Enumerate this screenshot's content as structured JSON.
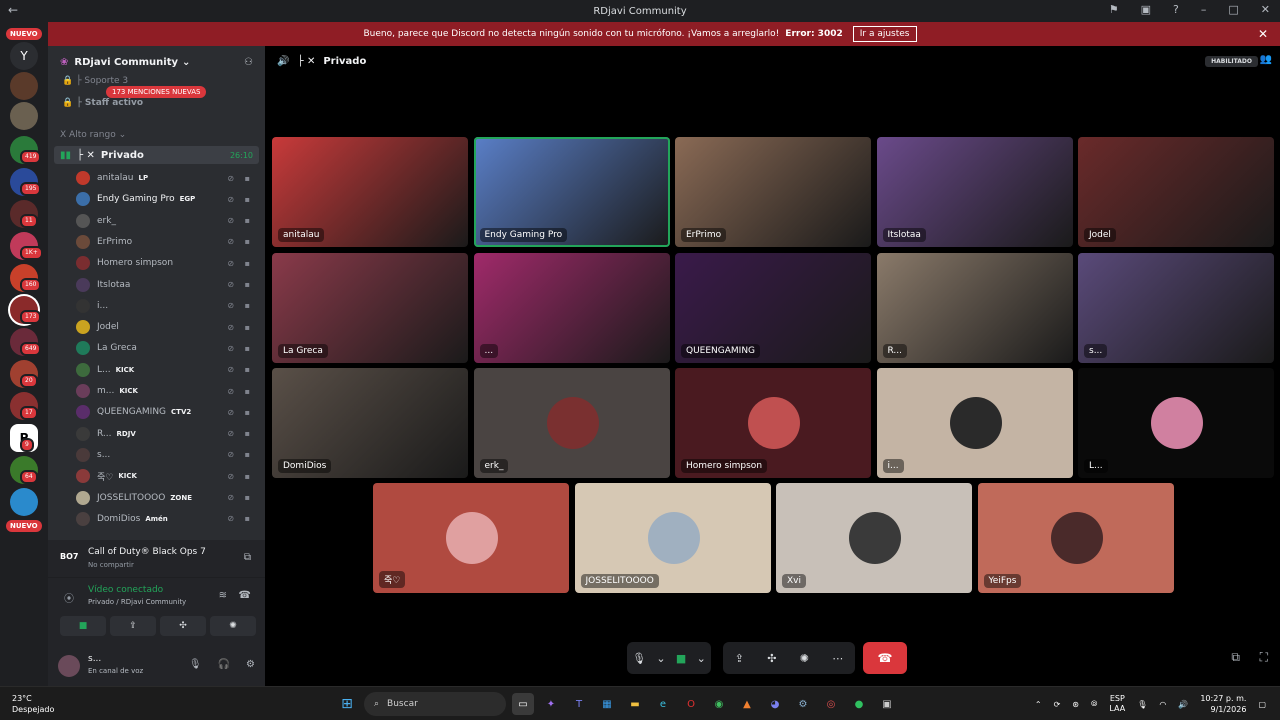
{
  "titlebar": {
    "title": "RDjavi Community"
  },
  "banner": {
    "message": "Bueno, parece que Discord no detecta ningún sonido con tu micrófono. ¡Vamos a arreglarlo!",
    "error": "Error: 3002",
    "button": "Ir a ajustes"
  },
  "guilds": {
    "new_label": "NUEVO",
    "badges": [
      "419",
      "195",
      "11",
      "1K+",
      "160",
      "173",
      "649",
      "20",
      "17",
      "9",
      "64"
    ],
    "new_label_bottom": "NUEVO"
  },
  "server": {
    "name": "RDjavi Community",
    "channels_above": [
      "Soporte 3",
      "Staff activo"
    ],
    "mentions": "173 MENCIONES NUEVAS",
    "category": "Alto rango",
    "voice_channel": "Privado",
    "voice_time": "26:10",
    "members": [
      {
        "name": "anitalau",
        "tag": "LP",
        "color": "#c0392b"
      },
      {
        "name": "Endy Gaming Pro",
        "tag": "EGP",
        "color": "#3b6ea8",
        "bold": true
      },
      {
        "name": "erk_",
        "tag": "",
        "color": "#555555"
      },
      {
        "name": "ErPrimo",
        "tag": "",
        "color": "#6b4a3a"
      },
      {
        "name": "Homero simpson",
        "tag": "",
        "color": "#7a2d30"
      },
      {
        "name": "Itslotaa",
        "tag": "",
        "color": "#4a3a5a"
      },
      {
        "name": "i...",
        "tag": "",
        "color": "#333333"
      },
      {
        "name": "Jodel",
        "tag": "",
        "color": "#caa320"
      },
      {
        "name": "La Greca",
        "tag": "",
        "color": "#1f7a5a"
      },
      {
        "name": "L...",
        "tag": "KICK",
        "color": "#3d6a3d"
      },
      {
        "name": "m...",
        "tag": "KICK",
        "color": "#6a3d5a"
      },
      {
        "name": "QUEENGAMING",
        "tag": "CTV2",
        "color": "#5a2d6a"
      },
      {
        "name": "R...",
        "tag": "RDJV",
        "color": "#3a3a3a"
      },
      {
        "name": "s...",
        "tag": "",
        "color": "#4a3a3a"
      },
      {
        "name": "죽♡",
        "tag": "KICK",
        "color": "#8a3a3a"
      },
      {
        "name": "JOSSELITOOOO",
        "tag": "ZONE",
        "color": "#b0a890"
      },
      {
        "name": "DomiDios",
        "tag": "Amén",
        "color": "#4a4040"
      }
    ],
    "activity": {
      "title": "Call of Duty® Black Ops 7",
      "subtitle": "No compartir",
      "logo": "BO7"
    },
    "voice_status": {
      "title": "Vídeo conectado",
      "subtitle": "Privado / RDjavi Community"
    },
    "user": {
      "name": "s...",
      "status": "En canal de voz"
    }
  },
  "call": {
    "channel": "Privado",
    "enabled_badge": "HABILITADO",
    "tiles": [
      {
        "label": "anitalau",
        "bg": "#c83a3a"
      },
      {
        "label": "Endy Gaming Pro",
        "bg": "#5a7fc8",
        "speaking": true
      },
      {
        "label": "ErPrimo",
        "bg": "#8a6a55"
      },
      {
        "label": "Itslotaa",
        "bg": "#6a4a8a"
      },
      {
        "label": "Jodel",
        "bg": "#6a2a2a"
      },
      {
        "label": "La Greca",
        "bg": "#8a3a4a"
      },
      {
        "label": "...",
        "bg": "#a02a6a"
      },
      {
        "label": "QUEENGAMING",
        "bg": "#3a1a4a"
      },
      {
        "label": "R...",
        "bg": "#8a7a6a"
      },
      {
        "label": "s...",
        "bg": "#5a4a7a"
      },
      {
        "label": "DomiDios",
        "bg": "#5a5048"
      },
      {
        "label": "erk_",
        "bg": "#4a4442",
        "avatar": "#7a3030"
      },
      {
        "label": "Homero simpson",
        "bg": "#4a1a20",
        "avatar": "#c05050"
      },
      {
        "label": "i...",
        "bg": "#c4b4a4",
        "avatar": "#2a2a2a"
      },
      {
        "label": "L...",
        "bg": "#0a0a0a",
        "avatar": "#d080a0"
      },
      {
        "label": "죽♡",
        "bg": "#b04a40",
        "avatar": "#e0a0a0"
      },
      {
        "label": "JOSSELITOOOO",
        "bg": "#d6c8b4",
        "avatar": "#a0b0c0"
      },
      {
        "label": "Xvi",
        "bg": "#c8c0b8",
        "avatar": "#3a3a3a"
      },
      {
        "label": "YeiFps",
        "bg": "#c06a5a",
        "avatar": "#4a2a2a"
      }
    ]
  },
  "taskbar": {
    "temperature": "23°C",
    "weather": "Despejado",
    "search": "Buscar",
    "lang": "ESP",
    "layout": "LAA",
    "time": "10:27 p. m.",
    "date": "9/1/2026"
  }
}
